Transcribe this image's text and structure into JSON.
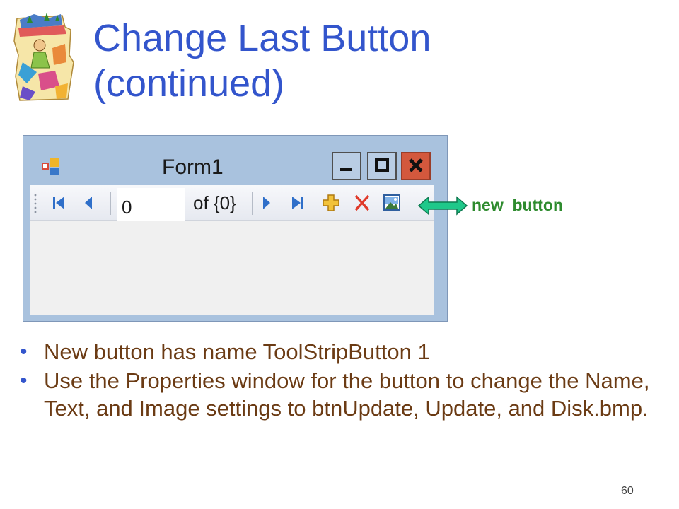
{
  "slide": {
    "title_line1": "Change Last Button",
    "title_line2": "(continued)",
    "page_number": "60"
  },
  "form": {
    "title": "Form1",
    "caption_buttons": [
      "minimize-icon",
      "maximize-icon",
      "close-icon"
    ],
    "toolbar": {
      "position_value": "0",
      "count_label": "of {0}",
      "icons": [
        "move-first-icon",
        "move-previous-icon",
        "move-next-icon",
        "move-last-icon",
        "add-new-icon",
        "delete-icon",
        "image-icon"
      ]
    }
  },
  "callout": {
    "label": "new  button",
    "color": "#2e8b2e"
  },
  "bullets": [
    "New button has name ToolStripButton 1",
    "Use the Properties window for the button to change the Name, Text, and Image settings to btnUpdate, Update, and Disk.bmp."
  ],
  "colors": {
    "title": "#3355cc",
    "bullet_text": "#6b3b14"
  }
}
